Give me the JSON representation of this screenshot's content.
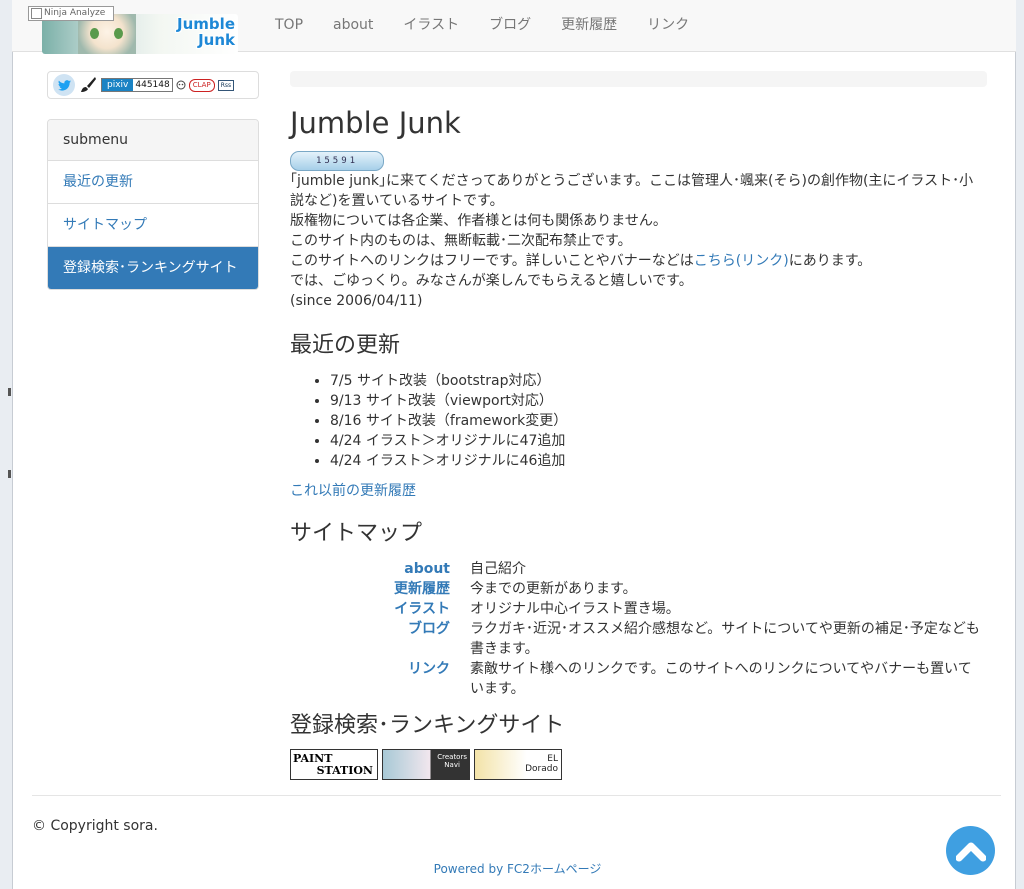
{
  "ninja_label": "Ninja Analyze",
  "logo": {
    "text": "Jumble Junk"
  },
  "nav": [
    {
      "label": "TOP"
    },
    {
      "label": "about"
    },
    {
      "label": "イラスト"
    },
    {
      "label": "ブログ"
    },
    {
      "label": "更新履歴"
    },
    {
      "label": "リンク"
    }
  ],
  "social": {
    "pixiv_label": "pixiv",
    "pixiv_count": "445148",
    "clap_label": "CLAP",
    "rss_label": "Rss"
  },
  "submenu": {
    "header": "submenu",
    "items": [
      {
        "label": "最近の更新"
      },
      {
        "label": "サイトマップ"
      },
      {
        "label": "登録検索･ランキングサイト"
      }
    ]
  },
  "main": {
    "title": "Jumble Junk",
    "counter": "15591",
    "intro": [
      "｢jumble junk｣に来てくださってありがとうございます。ここは管理人･颯来(そら)の創作物(主にイラスト･小説など)を置いているサイトです。",
      "版権物については各企業、作者様とは何も関係ありません。",
      "このサイト内のものは、無断転載･二次配布禁止です。",
      "このサイトへのリンクはフリーです。詳しいことやバナーなどは",
      "こちら(リンク)",
      "にあります。",
      "では、ごゆっくり。みなさんが楽しんでもらえると嬉しいです。",
      "(since 2006/04/11)"
    ],
    "updates_heading": "最近の更新",
    "updates": [
      "7/5 サイト改装（bootstrap対応）",
      "9/13 サイト改装（viewport対応）",
      "8/16 サイト改装（framework変更）",
      "4/24 イラスト＞オリジナルに47追加",
      "4/24 イラスト＞オリジナルに46追加"
    ],
    "more_link": "これ以前の更新履歴",
    "sitemap_heading": "サイトマップ",
    "sitemap": [
      {
        "term": "about",
        "desc": "自己紹介"
      },
      {
        "term": "更新履歴",
        "desc": "今までの更新があります。"
      },
      {
        "term": "イラスト",
        "desc": "オリジナル中心イラスト置き場。"
      },
      {
        "term": "ブログ",
        "desc": "ラクガキ･近況･オススメ紹介感想など。サイトについてや更新の補足･予定なども書きます。"
      },
      {
        "term": "リンク",
        "desc": "素敵サイト様へのリンクです。このサイトへのリンクについてやバナーも置いています。"
      }
    ],
    "ranking_heading": "登録検索･ランキングサイト",
    "banners": [
      {
        "line1": "PAINT",
        "line2": "STATION"
      },
      {
        "line1": "Creators",
        "line2": "Navi"
      },
      {
        "line1": "EL",
        "line2": "Dorado"
      }
    ]
  },
  "footer": {
    "copyright": "© Copyright sora.",
    "powered": "Powered by FC2ホームページ"
  }
}
